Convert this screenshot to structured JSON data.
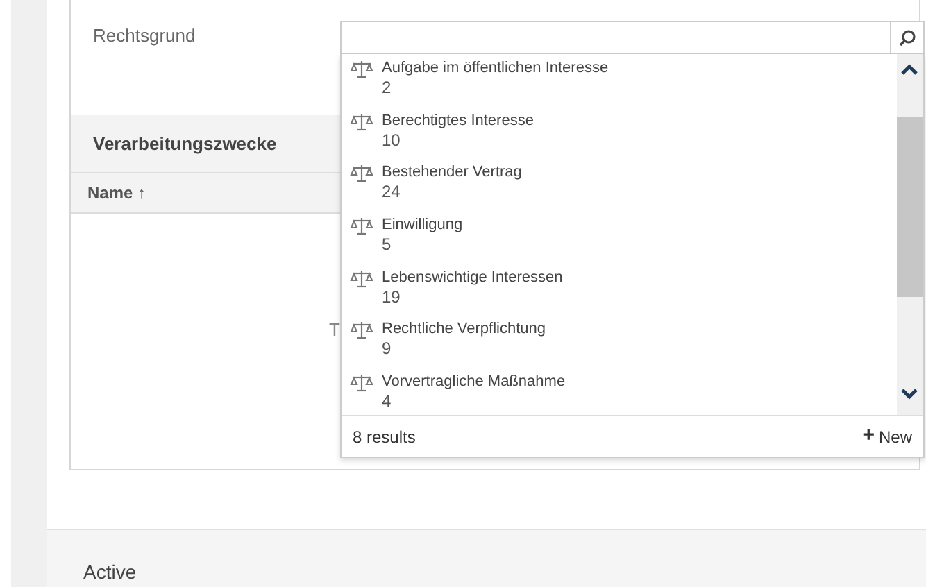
{
  "field": {
    "label": "Rechtsgrund"
  },
  "section": {
    "title": "Verarbeitungszwecke",
    "column": "Name ↑",
    "empty_text": "T"
  },
  "dropdown": {
    "items": [
      {
        "name": "Aufgabe im öffentlichen Interesse",
        "count": "2"
      },
      {
        "name": "Berechtigtes Interesse",
        "count": "10"
      },
      {
        "name": "Bestehender Vertrag",
        "count": "24"
      },
      {
        "name": "Einwilligung",
        "count": "5"
      },
      {
        "name": "Lebenswichtige Interessen",
        "count": "19"
      },
      {
        "name": "Rechtliche Verpflichtung",
        "count": "9"
      },
      {
        "name": "Vorvertragliche Maßnahme",
        "count": "4"
      }
    ],
    "results": "8 results",
    "new_label": "New",
    "new_symbol": "+"
  },
  "footer": {
    "status": "Active"
  }
}
